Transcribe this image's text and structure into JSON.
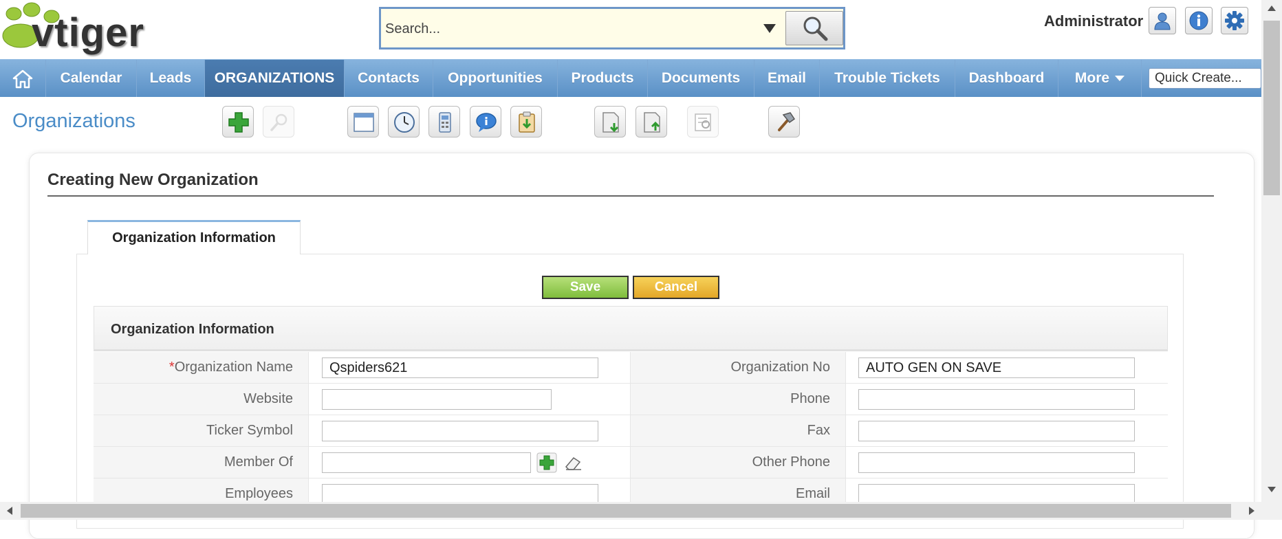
{
  "header": {
    "logo_text": "vtiger",
    "search": {
      "placeholder": "Search..."
    },
    "user_label": "Administrator",
    "icons": [
      "user-icon",
      "info-icon",
      "settings-gear-icon"
    ]
  },
  "nav": {
    "home_icon": "home-icon",
    "items": [
      {
        "label": "Calendar"
      },
      {
        "label": "Leads"
      },
      {
        "label": "ORGANIZATIONS",
        "active": true
      },
      {
        "label": "Contacts"
      },
      {
        "label": "Opportunities"
      },
      {
        "label": "Products"
      },
      {
        "label": "Documents"
      },
      {
        "label": "Email"
      },
      {
        "label": "Trouble Tickets"
      },
      {
        "label": "Dashboard"
      },
      {
        "label": "More"
      }
    ],
    "quick_create_placeholder": "Quick Create..."
  },
  "module": {
    "title": "Organizations",
    "toolbar_icons": [
      "add-plus-icon",
      "search-disabled-icon",
      "calendar-icon",
      "clock-icon",
      "calculator-icon",
      "chat-icon",
      "clipboard-icon",
      "import-icon",
      "export-icon",
      "find-duplicates-icon",
      "settings-hammer-icon"
    ]
  },
  "form": {
    "heading": "Creating New Organization",
    "tab_label": "Organization Information",
    "save_label": "Save",
    "cancel_label": "Cancel",
    "section_title": "Organization Information",
    "required_mark": "*",
    "rows": [
      {
        "left_label": "Organization Name",
        "left_value": "Qspiders621",
        "right_label": "Organization No",
        "right_value": "AUTO GEN ON SAVE"
      },
      {
        "left_label": "Website",
        "left_value": "",
        "right_label": "Phone",
        "right_value": ""
      },
      {
        "left_label": "Ticker Symbol",
        "left_value": "",
        "right_label": "Fax",
        "right_value": ""
      },
      {
        "left_label": "Member Of",
        "left_value": "",
        "right_label": "Other Phone",
        "right_value": ""
      },
      {
        "left_label": "Employees",
        "left_value": "",
        "right_label": "Email",
        "right_value": ""
      }
    ]
  },
  "colors": {
    "nav_blue": "#5a90c6",
    "active_tab": "#3e6c9e",
    "module_title": "#4a8cc7",
    "save_green": "#7fbd3c",
    "cancel_yellow": "#e3a728",
    "required_red": "#dd3333"
  }
}
